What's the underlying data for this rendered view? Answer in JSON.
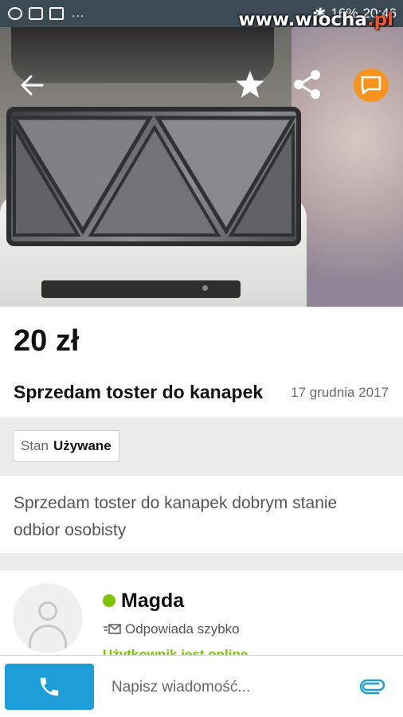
{
  "status_bar": {
    "left_overflow": "...",
    "battery": "16%",
    "time": "20:46"
  },
  "watermark": {
    "main": "www.wiocha",
    "tld": ".pl"
  },
  "hero": {
    "icons": {
      "back": "back-arrow-icon",
      "favorite": "star-icon",
      "share": "share-icon",
      "chat": "chat-bubble-icon"
    },
    "accent_color": "#f7941d"
  },
  "listing": {
    "price": "20 zł",
    "title": "Sprzedam toster do kanapek",
    "date": "17 grudnia 2017",
    "condition_label": "Stan",
    "condition_value": "Używane",
    "description_line1": "Sprzedam toster do kanapek dobrym stanie",
    "description_line2": "odbior osobisty"
  },
  "seller": {
    "name": "Magda",
    "response": "Odpowiada szybko",
    "status": "Użytkownik jest online",
    "online_color": "#7cc300"
  },
  "bottom_bar": {
    "message_placeholder": "Napisz wiadomość...",
    "call_color": "#1e9ed8",
    "icons": {
      "call": "phone-icon",
      "attach": "paperclip-icon"
    }
  }
}
